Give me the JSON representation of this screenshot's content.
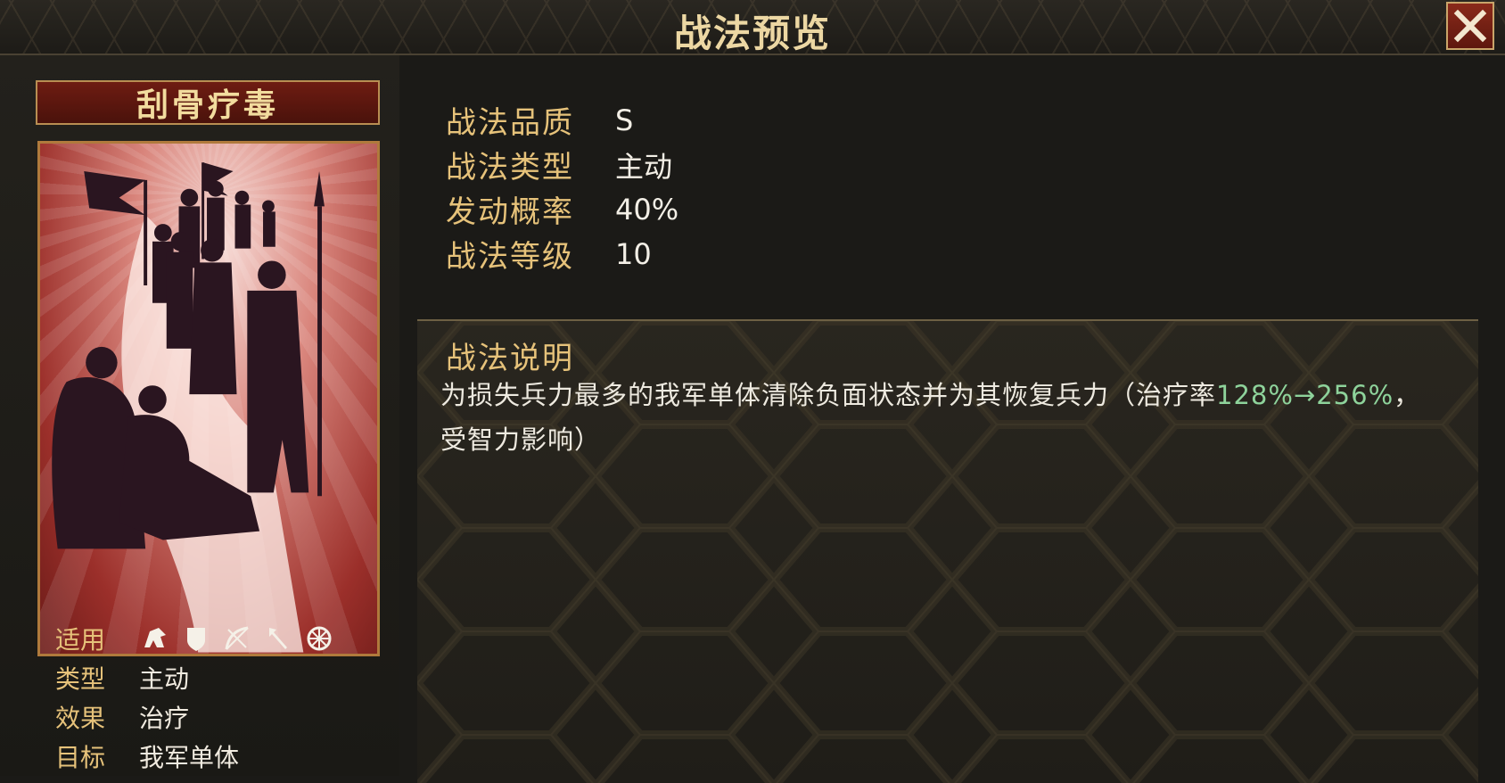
{
  "header": {
    "title": "战法预览"
  },
  "skill": {
    "name": "刮骨疗毒",
    "properties": [
      {
        "label": "战法品质",
        "value": "S"
      },
      {
        "label": "战法类型",
        "value": "主动"
      },
      {
        "label": "发动概率",
        "value": "40%"
      },
      {
        "label": "战法等级",
        "value": "10"
      }
    ],
    "description_title": "战法说明",
    "description": {
      "part1": "为损失兵力最多的我军单体清除负面状态并为其恢复兵力（治疗率",
      "highlight": "128%→256%",
      "part2": "，受智力影响）"
    },
    "meta": {
      "applicable_label": "适用",
      "applicable_icons": [
        "cavalry-icon",
        "shield-icon",
        "bow-icon",
        "spear-icon",
        "chariot-wheel-icon"
      ],
      "type_label": "类型",
      "type_value": "主动",
      "effect_label": "效果",
      "effect_value": "治疗",
      "target_label": "目标",
      "target_value": "我军单体"
    }
  },
  "colors": {
    "accent_gold": "#e6c27a",
    "highlight_green": "#8ed39b",
    "close_red": "#8a2a1a"
  }
}
